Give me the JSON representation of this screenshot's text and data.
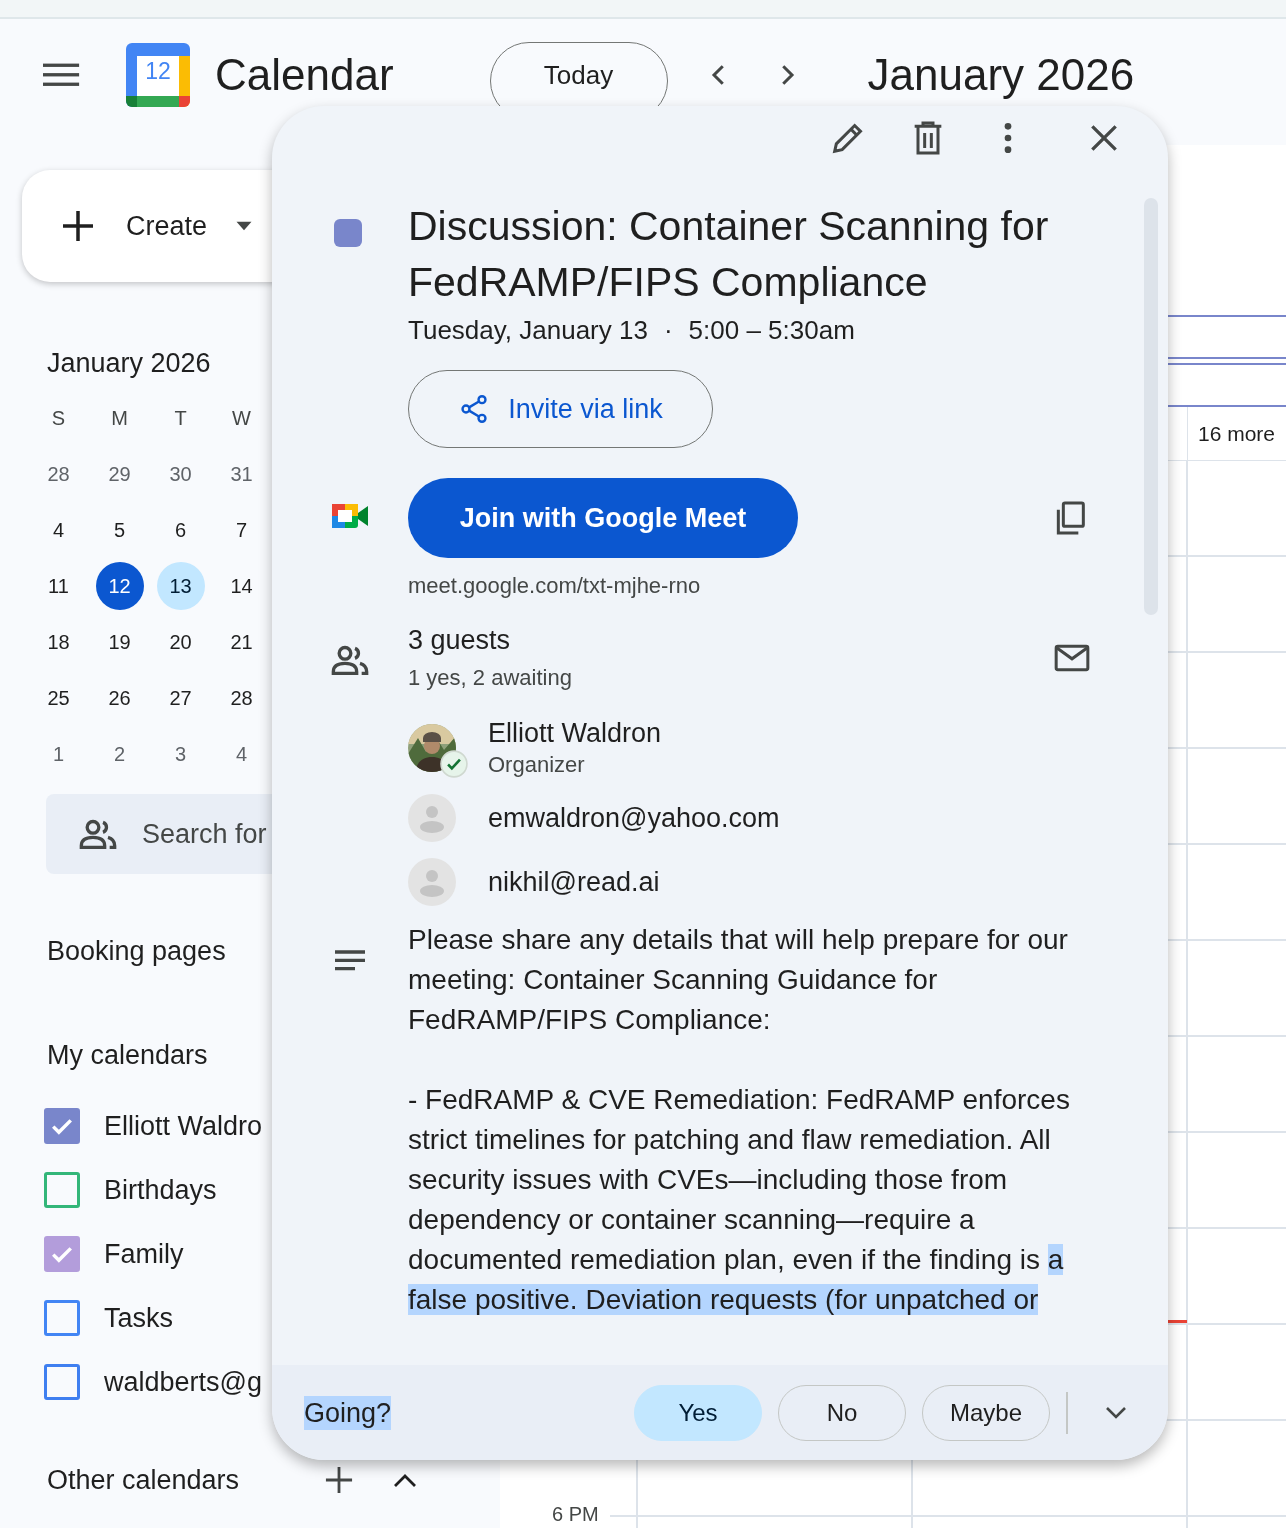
{
  "header": {
    "logo_day": "12",
    "app_name": "Calendar",
    "today_button": "Today",
    "month_title": "January 2026"
  },
  "sidebar": {
    "create_label": "Create",
    "mini_calendar": {
      "title": "January 2026",
      "weekdays": [
        "S",
        "M",
        "T",
        "W"
      ],
      "weeks": [
        [
          {
            "day": "28",
            "muted": true,
            "today": false,
            "selected": false
          },
          {
            "day": "29",
            "muted": true,
            "today": false,
            "selected": false
          },
          {
            "day": "30",
            "muted": true,
            "today": false,
            "selected": false
          },
          {
            "day": "31",
            "muted": true,
            "today": false,
            "selected": false
          }
        ],
        [
          {
            "day": "4",
            "muted": false,
            "today": false,
            "selected": false
          },
          {
            "day": "5",
            "muted": false,
            "today": false,
            "selected": false
          },
          {
            "day": "6",
            "muted": false,
            "today": false,
            "selected": false
          },
          {
            "day": "7",
            "muted": false,
            "today": false,
            "selected": false
          }
        ],
        [
          {
            "day": "11",
            "muted": false,
            "today": false,
            "selected": false
          },
          {
            "day": "12",
            "muted": false,
            "today": true,
            "selected": false
          },
          {
            "day": "13",
            "muted": false,
            "today": false,
            "selected": true
          },
          {
            "day": "14",
            "muted": false,
            "today": false,
            "selected": false
          }
        ],
        [
          {
            "day": "18",
            "muted": false,
            "today": false,
            "selected": false
          },
          {
            "day": "19",
            "muted": false,
            "today": false,
            "selected": false
          },
          {
            "day": "20",
            "muted": false,
            "today": false,
            "selected": false
          },
          {
            "day": "21",
            "muted": false,
            "today": false,
            "selected": false
          }
        ],
        [
          {
            "day": "25",
            "muted": false,
            "today": false,
            "selected": false
          },
          {
            "day": "26",
            "muted": false,
            "today": false,
            "selected": false
          },
          {
            "day": "27",
            "muted": false,
            "today": false,
            "selected": false
          },
          {
            "day": "28",
            "muted": false,
            "today": false,
            "selected": false
          }
        ],
        [
          {
            "day": "1",
            "muted": true,
            "today": false,
            "selected": false
          },
          {
            "day": "2",
            "muted": true,
            "today": false,
            "selected": false
          },
          {
            "day": "3",
            "muted": true,
            "today": false,
            "selected": false
          },
          {
            "day": "4",
            "muted": true,
            "today": false,
            "selected": false
          }
        ]
      ]
    },
    "people_search": {
      "placeholder": "Search for"
    },
    "booking_pages": "Booking pages",
    "my_calendars": {
      "title": "My calendars",
      "items": [
        {
          "label": "Elliott Waldro",
          "checked": true,
          "color": "#7986cb"
        },
        {
          "label": "Birthdays",
          "checked": false,
          "color": "#33b679"
        },
        {
          "label": "Family",
          "checked": true,
          "color": "#b39ddb"
        },
        {
          "label": "Tasks",
          "checked": false,
          "color": "#4285f4"
        },
        {
          "label": "waldberts@g",
          "checked": false,
          "color": "#3f7ff0"
        }
      ]
    },
    "other_calendars": "Other calendars"
  },
  "grid": {
    "more_label": "16 more",
    "time_label": "6 PM"
  },
  "event_popup": {
    "color": "#7986cb",
    "title": "Discussion: Container Scanning for FedRAMP/FIPS Compliance",
    "date": "Tuesday, January 13",
    "separator": "·",
    "time": "5:00 – 5:30am",
    "invite_button": "Invite via link",
    "meet_button": "Join with Google Meet",
    "meet_url": "meet.google.com/txt-mjhe-rno",
    "guests_title": "3 guests",
    "guests_summary": "1 yes, 2 awaiting",
    "guests": [
      {
        "name": "Elliott Waldron",
        "role": "Organizer",
        "accepted": true
      },
      {
        "kind": "placeholder",
        "name": "emwaldron@yahoo.com",
        "accepted": false
      },
      {
        "kind": "placeholder",
        "name": "nikhil@read.ai",
        "accepted": false
      }
    ],
    "description": [
      {
        "text": "Please share any details that will help prepare for our meeting: Container Scanning Guidance for FedRAMP/FIPS Compliance:"
      },
      {
        "text": "- FedRAMP & CVE Remediation: FedRAMP enforces strict timelines for patching and flaw remediation. All security issues with CVEs—including those from dependency or container scanning—require a documented remediation plan, even if the finding is ",
        "highlighted": "a false positive. Deviation requests (for unpatched or"
      }
    ],
    "rsvp": {
      "label": "Going?",
      "label_highlighted": true,
      "options": [
        {
          "label": "Yes",
          "selected": true
        },
        {
          "label": "No",
          "selected": false
        },
        {
          "label": "Maybe",
          "selected": false
        }
      ]
    }
  }
}
